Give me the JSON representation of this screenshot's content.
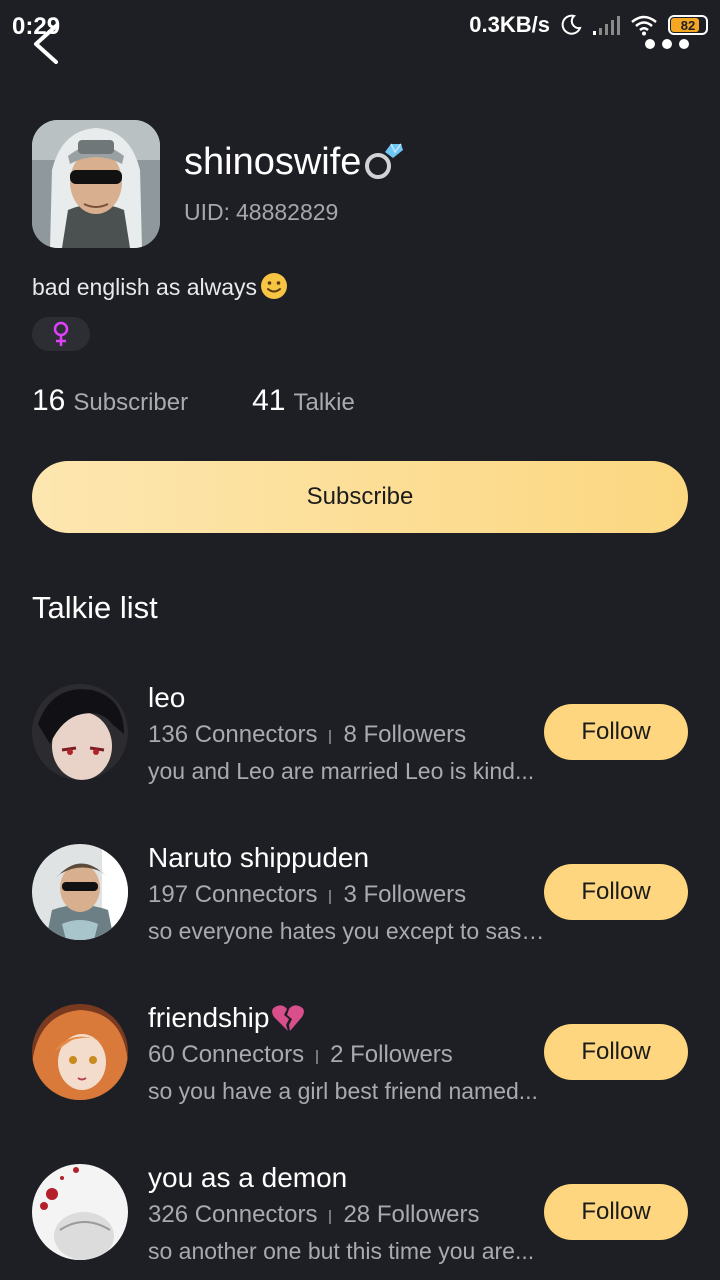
{
  "status_bar": {
    "time": "0:29",
    "speed": "0.3KB/s",
    "battery": "82",
    "battery_level": 0.82,
    "accent": "#f5a623"
  },
  "nav": {
    "back_icon": "chevron-left-icon",
    "more_icon": "more-dots-icon"
  },
  "profile": {
    "name": "shinoswife",
    "name_icon": "ring-icon",
    "uid_label": "UID:",
    "uid": "48882829",
    "bio": "bad english as always",
    "bio_icon": "smile-emoji-icon",
    "gender_icon": "female-icon",
    "gender_color": "#e040fb"
  },
  "stats": {
    "subscriber_count": "16",
    "subscriber_label": "Subscriber",
    "talkie_count": "41",
    "talkie_label": "Talkie"
  },
  "subscribe_label": "Subscribe",
  "talkie_list": {
    "title": "Talkie list",
    "items": [
      {
        "name": "leo",
        "connectors": "136 Connectors",
        "followers": "8 Followers",
        "desc": "you and Leo are married Leo is kind...",
        "follow_label": "Follow"
      },
      {
        "name": "Naruto shippuden",
        "connectors": "197 Connectors",
        "followers": "3 Followers",
        "desc": "so everyone hates you except to sasuke",
        "follow_label": "Follow"
      },
      {
        "name": "friendship",
        "name_icon": "broken-heart-icon",
        "connectors": "60 Connectors",
        "followers": "2 Followers",
        "desc": "so you have a girl best friend named...",
        "follow_label": "Follow"
      },
      {
        "name": "you as a demon",
        "connectors": "326 Connectors",
        "followers": "28 Followers",
        "desc": "so another one but this time you are...",
        "follow_label": "Follow"
      }
    ]
  },
  "colors": {
    "background": "#1e1f24",
    "button": "#fdd67f",
    "muted_text": "#a9aab0"
  }
}
